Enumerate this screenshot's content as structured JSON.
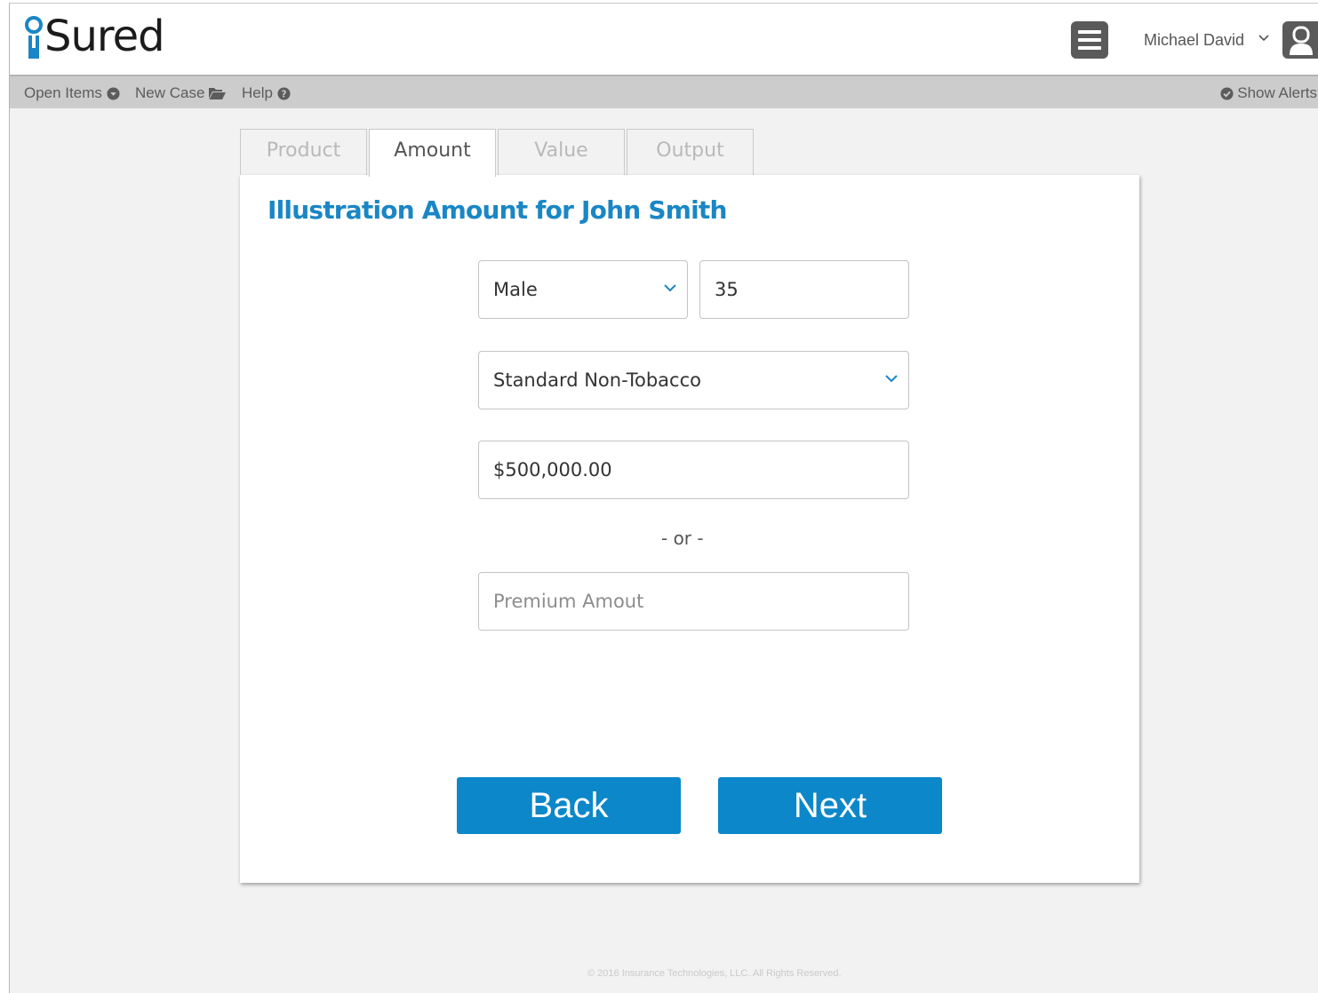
{
  "app": {
    "logo_text": "Sured"
  },
  "header": {
    "user_name": "Michael David"
  },
  "toolbar": {
    "open_items": "Open Items",
    "new_case": "New Case",
    "help": "Help",
    "show_alerts": "Show Alerts"
  },
  "tabs": [
    {
      "label": "Product",
      "active": false
    },
    {
      "label": "Amount",
      "active": true
    },
    {
      "label": "Value",
      "active": false
    },
    {
      "label": "Output",
      "active": false
    }
  ],
  "form": {
    "title": "Illustration Amount for John Smith",
    "gender": "Male",
    "age": "35",
    "rate_class": "Standard Non-Tobacco",
    "face_amount": "$500,000.00",
    "or_text": "- or -",
    "premium_placeholder": "Premium Amout"
  },
  "buttons": {
    "back": "Back",
    "next": "Next"
  },
  "footer": {
    "copyright": "© 2016 Insurance Technologies, LLC. All Rights Reserved."
  },
  "colors": {
    "accent": "#1a86c5",
    "button": "#0c87c9",
    "toolbar": "#cccccc",
    "dark_icon": "#5a5a5a"
  }
}
